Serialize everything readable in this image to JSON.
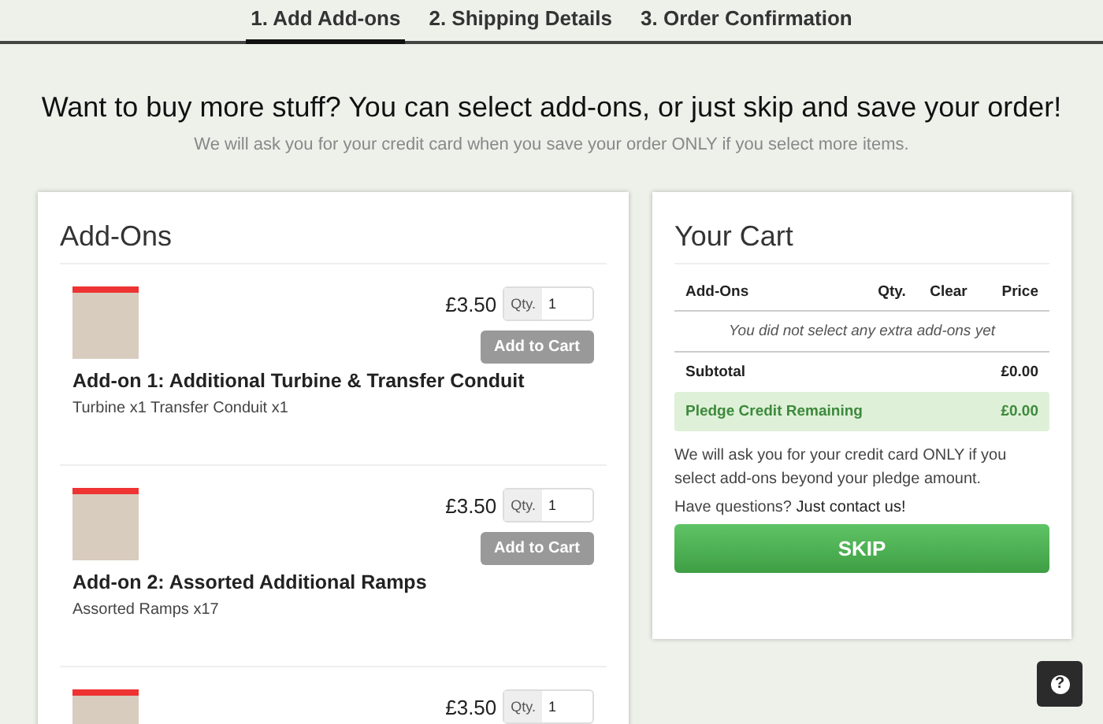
{
  "steps": [
    {
      "label": "1. Add Add-ons",
      "selected": true
    },
    {
      "label": "2. Shipping Details",
      "selected": false
    },
    {
      "label": "3. Order Confirmation",
      "selected": false
    }
  ],
  "headline": "Want to buy more stuff? You can select add-ons, or just skip and save your order!",
  "subheadline": "We will ask you for your credit card when you save your order ONLY if you select more items.",
  "addons_panel": {
    "title": "Add-Ons",
    "items": [
      {
        "title": "Add-on 1: Additional Turbine & Transfer Conduit",
        "contents": "Turbine x1 Transfer Conduit x1",
        "price": "£3.50",
        "qty_label": "Qty.",
        "qty": "1",
        "button": "Add to Cart"
      },
      {
        "title": "Add-on 2: Assorted Additional Ramps",
        "contents": "Assorted Ramps x17",
        "price": "£3.50",
        "qty_label": "Qty.",
        "qty": "1",
        "button": "Add to Cart"
      },
      {
        "price": "£3.50",
        "qty_label": "Qty.",
        "qty": "1"
      }
    ]
  },
  "cart": {
    "title": "Your Cart",
    "columns": [
      "Add-Ons",
      "Qty.",
      "Clear",
      "Price"
    ],
    "empty_message": "You did not select any extra add-ons yet",
    "subtotal_label": "Subtotal",
    "subtotal": "£0.00",
    "credit_label": "Pledge Credit Remaining",
    "credit": "£0.00",
    "note": "We will ask you for your credit card ONLY if you select add-ons beyond your pledge amount.",
    "question": "Have questions?",
    "contact_link": "Just contact us!",
    "skip_button": "SKIP"
  },
  "help_button": "?"
}
